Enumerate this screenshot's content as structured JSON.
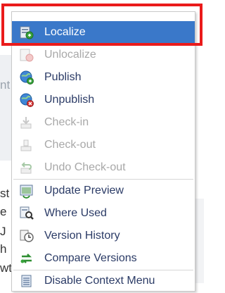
{
  "background": {
    "chars": [
      "st",
      "e",
      "J",
      "h",
      "wt",
      "nt"
    ]
  },
  "menu": {
    "items": [
      {
        "label": "Localize",
        "icon": "localize-icon",
        "enabled": true,
        "selected": true
      },
      {
        "label": "Unlocalize",
        "icon": "unlocalize-icon",
        "enabled": false,
        "selected": false
      },
      {
        "label": "Publish",
        "icon": "publish-icon",
        "enabled": true,
        "selected": false
      },
      {
        "label": "Unpublish",
        "icon": "unpublish-icon",
        "enabled": true,
        "selected": false
      },
      {
        "label": "Check-in",
        "icon": "check-in-icon",
        "enabled": false,
        "selected": false
      },
      {
        "label": "Check-out",
        "icon": "check-out-icon",
        "enabled": false,
        "selected": false
      },
      {
        "label": "Undo Check-out",
        "icon": "undo-check-out-icon",
        "enabled": false,
        "selected": false
      },
      {
        "label": "Update Preview",
        "icon": "update-preview-icon",
        "enabled": true,
        "selected": false
      },
      {
        "label": "Where Used",
        "icon": "where-used-icon",
        "enabled": true,
        "selected": false
      },
      {
        "label": "Version History",
        "icon": "version-history-icon",
        "enabled": true,
        "selected": false
      },
      {
        "label": "Compare Versions",
        "icon": "compare-versions-icon",
        "enabled": true,
        "selected": false
      },
      {
        "label": "Disable Context Menu",
        "icon": "disable-context-menu-icon",
        "enabled": true,
        "selected": false
      }
    ]
  },
  "colors": {
    "selection": "#3a78c9",
    "label": "#2b3b66",
    "disabled": "#a8a8a8",
    "highlight": "#ea1b1b"
  }
}
